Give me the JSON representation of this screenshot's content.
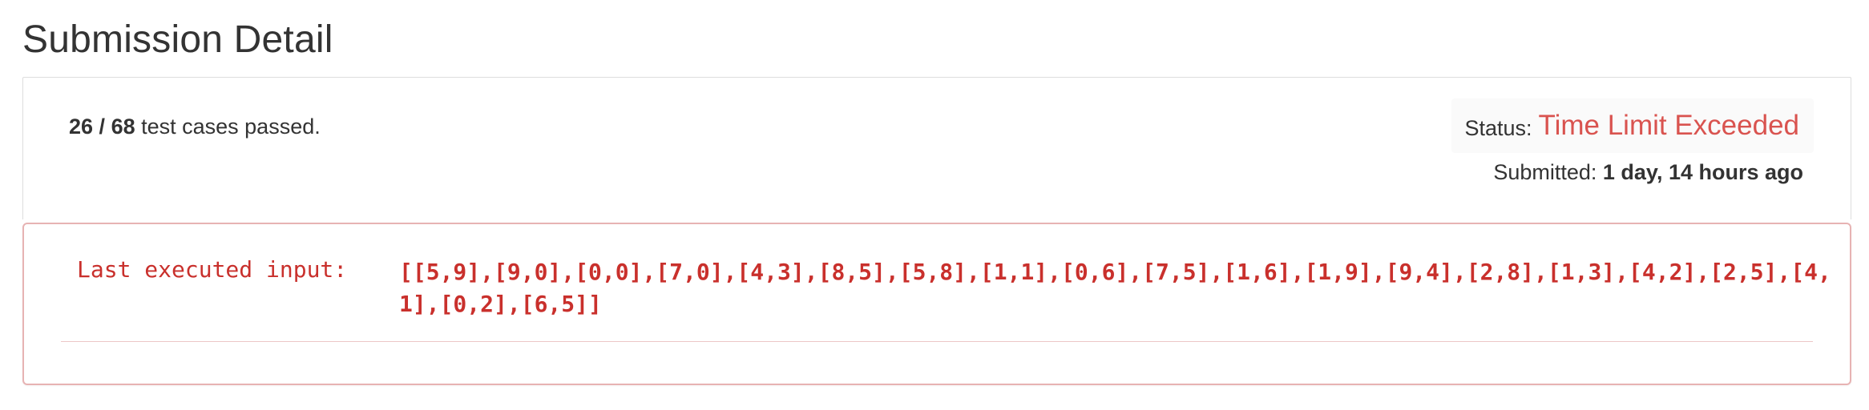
{
  "page": {
    "title": "Submission Detail"
  },
  "summary": {
    "passed": "26",
    "separator": " / ",
    "total": "68",
    "suffix": " test cases passed.",
    "status_label": "Status:",
    "status_value": "Time Limit Exceeded",
    "submitted_label": "Submitted: ",
    "submitted_value": "1 day, 14 hours ago"
  },
  "error": {
    "label": "Last executed input:",
    "value": "[[5,9],[9,0],[0,0],[7,0],[4,3],[8,5],[5,8],[1,1],[0,6],[7,5],[1,6],[1,9],[9,4],[2,8],[1,3],[4,2],[2,5],[4,1],[0,2],[6,5]]"
  },
  "colors": {
    "error": "#d9534f",
    "text": "#333333",
    "panel_border": "#dddddd",
    "error_border": "#e7b3b3"
  }
}
